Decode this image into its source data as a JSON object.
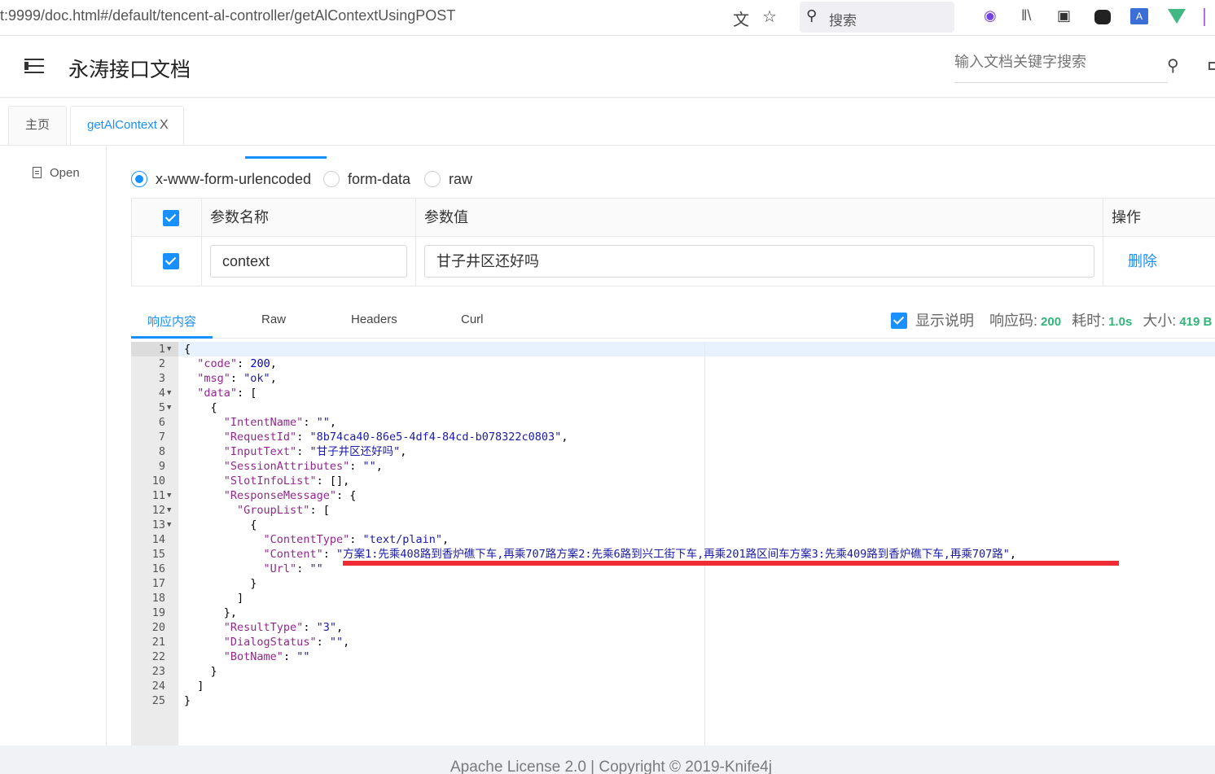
{
  "browser": {
    "url": "t:9999/doc.html#/default/tencent-al-controller/getAlContextUsingPOST",
    "search_label": "搜索"
  },
  "header": {
    "title": "永涛接口文档",
    "search_placeholder": "输入文档关键字搜索"
  },
  "tabs": [
    {
      "label": "主页"
    },
    {
      "label": "getAlContext",
      "close": "X"
    }
  ],
  "sidebar": {
    "items": [
      {
        "label": "Open"
      }
    ]
  },
  "body_type": {
    "options": [
      "x-www-form-urlencoded",
      "form-data",
      "raw"
    ],
    "selected": "x-www-form-urlencoded"
  },
  "params": {
    "headers": [
      "参数名称",
      "参数值",
      "操作"
    ],
    "rows": [
      {
        "name": "context",
        "value": "甘子井区还好吗",
        "action": "删除"
      }
    ]
  },
  "response": {
    "tabs": [
      "响应内容",
      "Raw",
      "Headers",
      "Curl"
    ],
    "show_desc_label": "显示说明",
    "code_label": "响应码:",
    "code_value": "200",
    "time_label": "耗时:",
    "time_value": "1.0s",
    "size_label": "大小:",
    "size_value": "419 B"
  },
  "code_lines": [
    "{",
    "  \"code\": 200,",
    "  \"msg\": \"ok\",",
    "  \"data\": [",
    "    {",
    "      \"IntentName\": \"\",",
    "      \"RequestId\": \"8b74ca40-86e5-4df4-84cd-b078322c0803\",",
    "      \"InputText\": \"甘子井区还好吗\",",
    "      \"SessionAttributes\": \"\",",
    "      \"SlotInfoList\": [],",
    "      \"ResponseMessage\": {",
    "        \"GroupList\": [",
    "          {",
    "            \"ContentType\": \"text/plain\",",
    "            \"Content\": \"方案1:先乘408路到香炉礁下车,再乘707路方案2:先乘6路到兴工街下车,再乘201路区间车方案3:先乘409路到香炉礁下车,再乘707路\",",
    "            \"Url\": \"\"",
    "          }",
    "        ]",
    "      },",
    "      \"ResultType\": \"3\",",
    "      \"DialogStatus\": \"\",",
    "      \"BotName\": \"\"",
    "    }",
    "  ]",
    "}"
  ],
  "fold_lines": [
    1,
    4,
    5,
    11,
    12,
    13
  ],
  "footer": {
    "text": "Apache License 2.0 | Copyright © 2019-Knife4j"
  },
  "colors": {
    "accent": "#1890ff",
    "success": "#32b47a",
    "annotation": "#ef2b34"
  }
}
